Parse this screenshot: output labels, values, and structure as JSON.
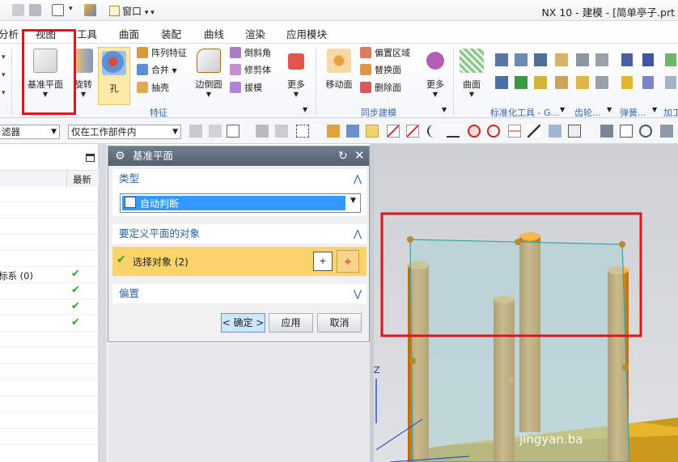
{
  "titlebar": {
    "window_menu": "窗口",
    "title": "NX 10 - 建模 - [简单亭子.prt"
  },
  "menu": {
    "items": [
      "分析",
      "视图",
      "工具",
      "曲面",
      "装配",
      "曲线",
      "渲染",
      "应用模块"
    ]
  },
  "ribbon": {
    "datum_plane": "基准平面",
    "rotate": "旋转",
    "hole": "孔",
    "pattern_feature": "阵列特征",
    "unite": "合并",
    "shell": "抽壳",
    "edge_blend": "边倒圆",
    "chamfer": "倒斜角",
    "trim_body": "修剪体",
    "draft": "拔模",
    "more_feature": "更多",
    "feature_group": "特征",
    "move_face": "移动面",
    "offset_region": "偏置区域",
    "replace_face": "替换面",
    "delete_face": "删除面",
    "more_sync": "更多",
    "sync_group": "同步建模",
    "surface": "曲面",
    "std_tools_group": "标准化工具 - G...",
    "gear_group": "齿轮...",
    "spring_group": "弹簧...",
    "machining_group": "加工"
  },
  "toolbar2": {
    "filter": "滤器",
    "scope": "仅在工作部件内"
  },
  "navigator": {
    "header_latest": "最新",
    "coord_row": "标系 (0)"
  },
  "dialog": {
    "title": "基准平面",
    "type_section": "类型",
    "type_value": "自动判断",
    "objects_section": "要定义平面的对象",
    "select_objects": "选择对象 (2)",
    "offset_section": "偏置",
    "ok": "< 确定 >",
    "apply": "应用",
    "cancel": "取消"
  },
  "viewport": {
    "axis_z": "Z",
    "watermark": "jingyan.ba"
  },
  "colors": {
    "highlight": "#e0141e",
    "pillar": "#e08a10",
    "plane": "#a7cfd4",
    "title_blue": "#2b5fa0"
  }
}
